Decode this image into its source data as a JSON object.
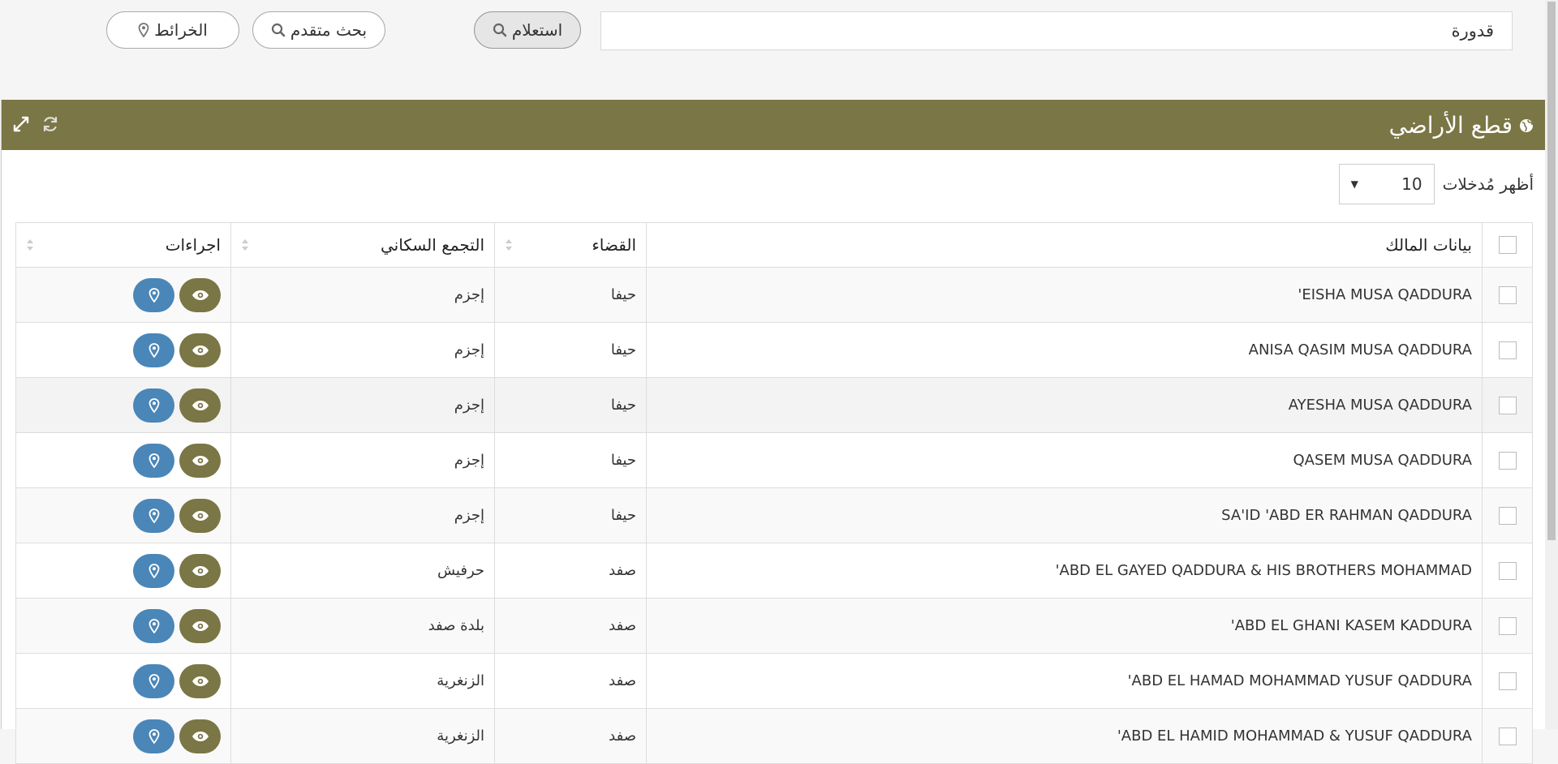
{
  "search": {
    "value": "قدورة"
  },
  "buttons": {
    "query": "استعلام",
    "advanced": "بحث متقدم",
    "maps": "الخرائط"
  },
  "panel": {
    "title": "قطع الأراضي"
  },
  "length": {
    "label": "أظهر مُدخلات",
    "value": "10"
  },
  "table": {
    "headers": {
      "owner": "بيانات المالك",
      "district": "القضاء",
      "locality": "التجمع السكاني",
      "actions": "اجراءات"
    },
    "rows": [
      {
        "owner": "EISHA MUSA QADDURA'",
        "district": "حيفا",
        "locality": "إجزم"
      },
      {
        "owner": "ANISA QASIM MUSA QADDURA",
        "district": "حيفا",
        "locality": "إجزم"
      },
      {
        "owner": "AYESHA MUSA QADDURA",
        "district": "حيفا",
        "locality": "إجزم"
      },
      {
        "owner": "QASEM MUSA QADDURA",
        "district": "حيفا",
        "locality": "إجزم"
      },
      {
        "owner": "SA'ID 'ABD ER RAHMAN QADDURA",
        "district": "حيفا",
        "locality": "إجزم"
      },
      {
        "owner": "ABD EL GAYED QADDURA & HIS BROTHERS MOHAMMAD'",
        "district": "صفد",
        "locality": "حرفيش"
      },
      {
        "owner": "ABD EL GHANI KASEM KADDURA'",
        "district": "صفد",
        "locality": "بلدة صفد"
      },
      {
        "owner": "ABD EL HAMAD MOHAMMAD YUSUF QADDURA'",
        "district": "صفد",
        "locality": "الزنغرية"
      },
      {
        "owner": "ABD EL HAMID MOHAMMAD & YUSUF QADDURA'",
        "district": "صفد",
        "locality": "الزنغرية"
      }
    ]
  },
  "colors": {
    "header": "#7a7645",
    "view_button": "#7a7645",
    "map_button": "#4a86b8"
  },
  "icons": {
    "search": "search-icon",
    "map": "map-marker-icon",
    "globe": "globe-icon",
    "expand": "expand-icon",
    "refresh": "refresh-icon",
    "view": "eye-icon"
  }
}
